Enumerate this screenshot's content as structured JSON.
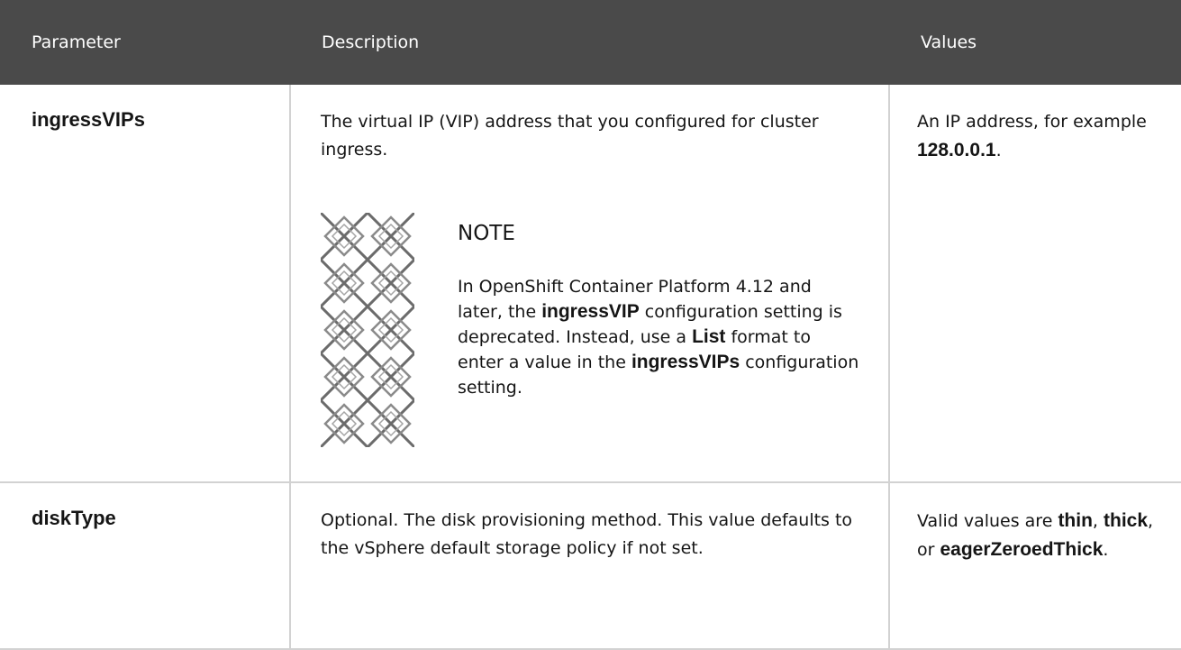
{
  "table": {
    "headers": {
      "parameter": "Parameter",
      "description": "Description",
      "values": "Values"
    },
    "rows": [
      {
        "parameter": "ingressVIPs",
        "description": "The virtual IP (VIP) address that you configured for cluster ingress.",
        "note": {
          "icon": "note-pattern-icon",
          "title": "NOTE",
          "segments": [
            "In OpenShift Container Platform 4.12 and later, the ",
            "ingressVIP",
            " configuration setting is deprecated. Instead, use a ",
            "List",
            " format to enter a value in the ",
            "ingressVIPs",
            " configuration setting."
          ]
        },
        "values": {
          "segments": [
            "An IP address, for example ",
            "128.0.0.1",
            "."
          ]
        }
      },
      {
        "parameter": "diskType",
        "description": "Optional. The disk provisioning method. This value defaults to the vSphere default storage policy if not set.",
        "values": {
          "segments": [
            "Valid values are ",
            "thin",
            ", ",
            "thick",
            ", or ",
            "eagerZeroedThick",
            "."
          ]
        }
      }
    ]
  },
  "colors": {
    "header_background": "#4a4a4a",
    "header_text": "#ffffff",
    "border": "#d2d2d2",
    "body_text": "#151515"
  }
}
